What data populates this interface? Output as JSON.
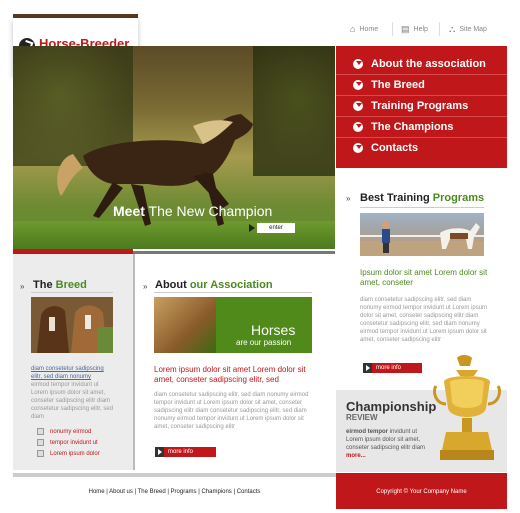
{
  "logo": {
    "line1": "Horse-Breeder",
    "line2": "association"
  },
  "toplinks": [
    {
      "label": "Home",
      "icon": "home-icon"
    },
    {
      "label": "Help",
      "icon": "help-icon"
    },
    {
      "label": "Site Map",
      "icon": "sitemap-icon"
    }
  ],
  "hero": {
    "meet": "Meet",
    "rest": "The New Champion",
    "enter": "enter"
  },
  "menu": [
    "About the association",
    "The Breed",
    "Training Programs",
    "The  Champions",
    "Contacts"
  ],
  "best": {
    "title_a": "Best Training ",
    "title_b": "Programs",
    "green_text": "Ipsum dolor sit amet Lorem dolor sit amet, conseter",
    "grey_text": "diam consetetur sadipscing elitr, sed diam nonumy eirmod tempor invidunt ut Lorem ipsum dolor sit amet, conseter sadipscing elitr diam consetetur sadipscing elitr, sed diam nonumy eirmod tempor invidunt ut Lorem ipsum dolor sit amet, conseter sadipscing elitr",
    "more": "more info"
  },
  "breed": {
    "title_a": "The ",
    "title_b": "Breed",
    "link_text": "diam consetetur sadipscing elitr, sed diam nonumy",
    "grey_text": "eirmod tempor invidunt ut Lorem ipsum dolor sit amet, conseter sadipscing elitr diam consetetur sadipscing elitr, sed diam",
    "checks": [
      "nonumy eirmod",
      "tempor invidunt ut",
      "Lorem ipsum dolor"
    ]
  },
  "about": {
    "title_a": "About ",
    "title_b": "our Association",
    "img_h1": "Horses",
    "img_h2": "are our passion",
    "red_text": "Lorem ipsum dolor sit amet Lorem dolor sit amet, conseter sadipscing elitr, sed",
    "grey_text": "diam consetetur sadipscing elitr, sed diam nonumy eirmod tempor invidunt ut Lorem ipsum dolor sit amet, conseter sadipscing elitr diam consetetur sadipscing elitr, sed diam nonumy eirmod tempor invidunt ut Lorem ipsum dolor sit amet, conseter sadipscing elitr",
    "more": "more info"
  },
  "championship": {
    "title": "Championship",
    "review": "REVIEW",
    "bold": "eirmod tempor",
    "text": " invidunt ut Lorem ipsum dolor sit amet, conseter sadipscing elitr diam ",
    "more": "more..."
  },
  "footer": {
    "links": "Home | About us | The Breed | Programs | Champions | Contacts",
    "copyright": "Copyright © Your Company Name"
  },
  "colors": {
    "brand_red": "#c0181a",
    "brand_green": "#4b8a1e"
  }
}
